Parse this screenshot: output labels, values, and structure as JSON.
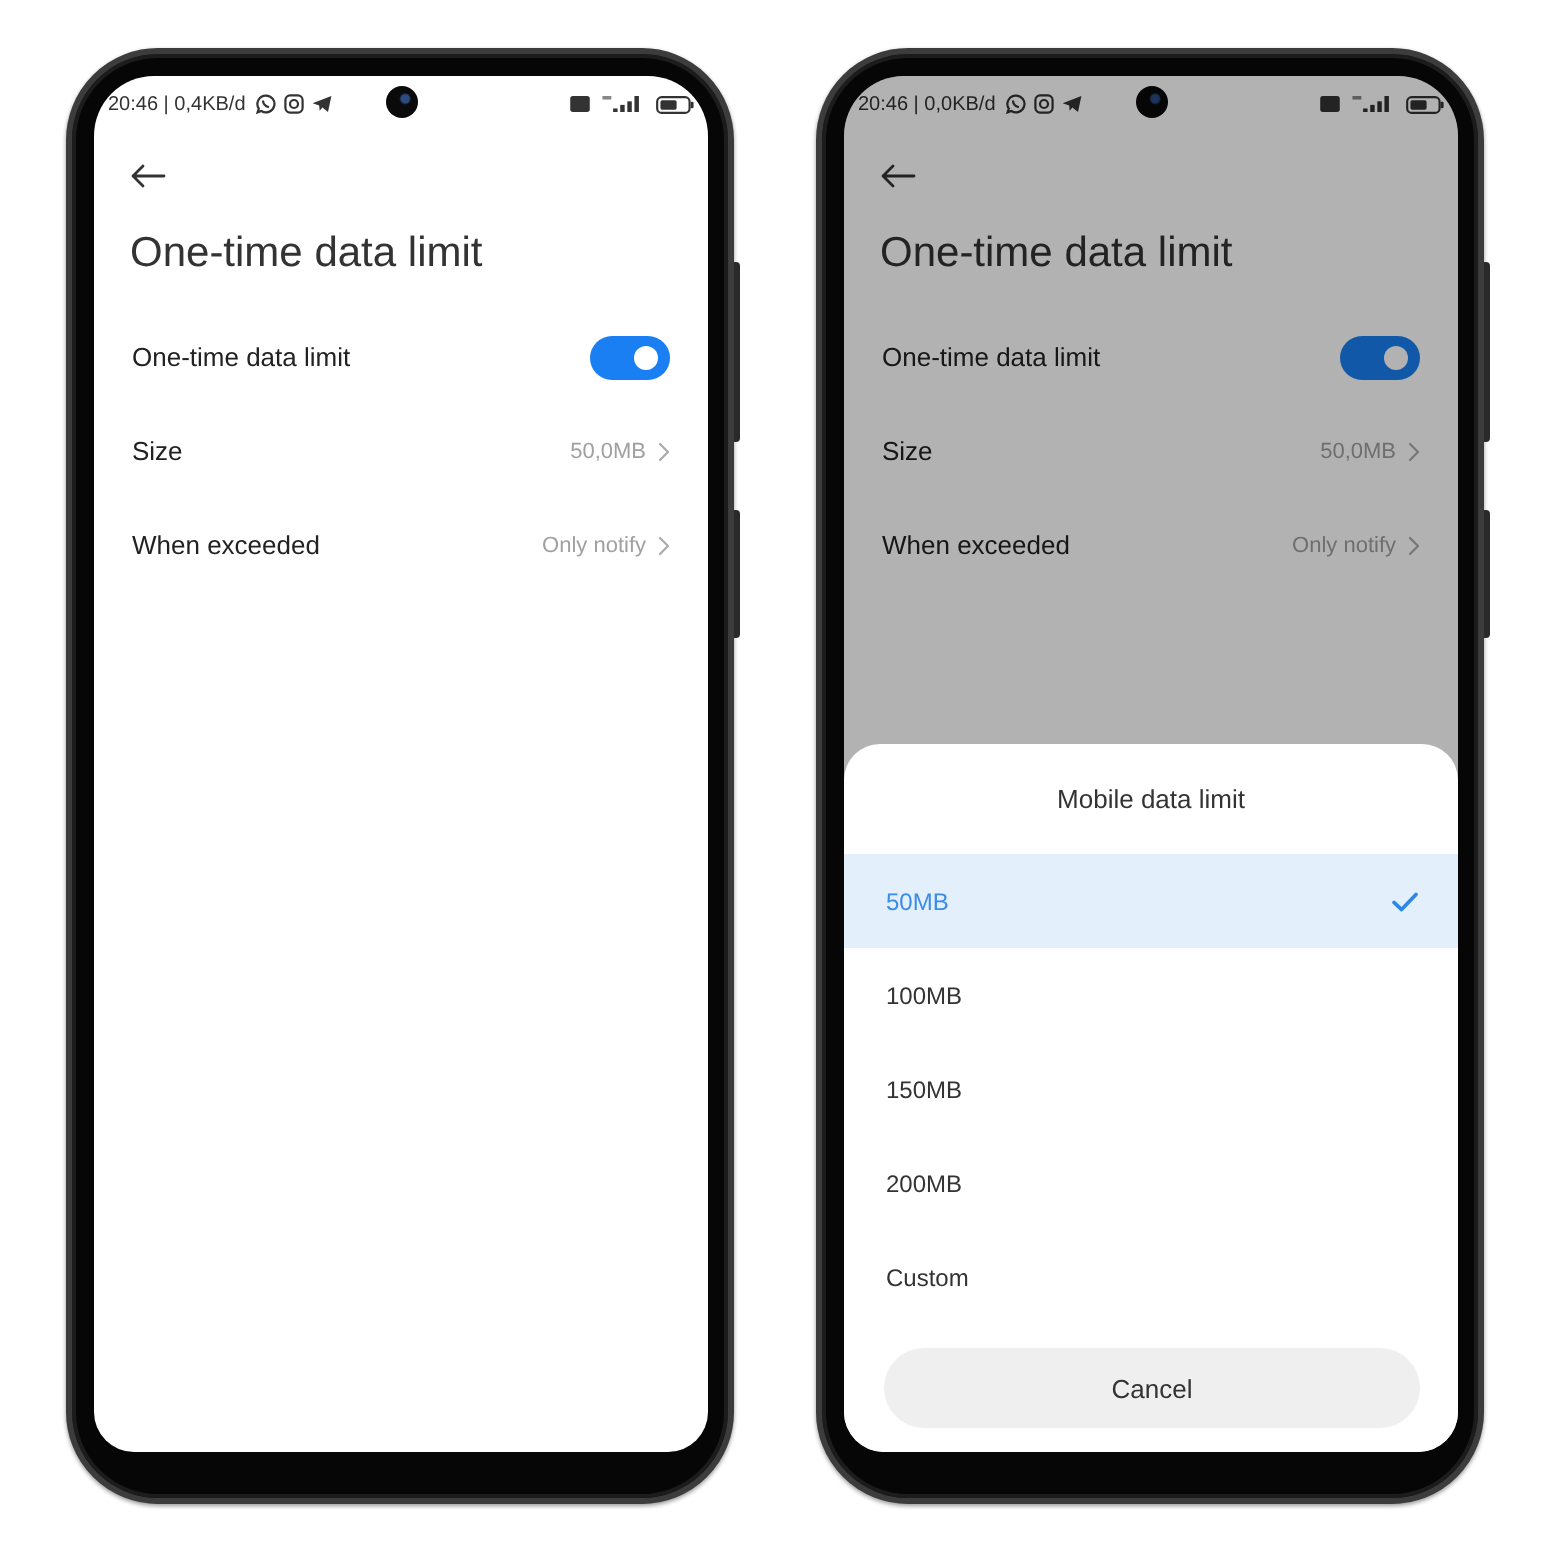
{
  "phones": [
    {
      "status_bar": {
        "text": "20:46 | 0,4KB/d"
      },
      "title": "One-time data limit",
      "dimmed": false,
      "settings": [
        {
          "kind": "toggle",
          "label": "One-time data limit",
          "on": true
        },
        {
          "kind": "link",
          "label": "Size",
          "value": "50,0MB"
        },
        {
          "kind": "link",
          "label": "When exceeded",
          "value": "Only notify"
        }
      ]
    },
    {
      "status_bar": {
        "text": "20:46 | 0,0KB/d"
      },
      "title": "One-time data limit",
      "dimmed": true,
      "settings": [
        {
          "kind": "toggle",
          "label": "One-time data limit",
          "on": true
        },
        {
          "kind": "link",
          "label": "Size",
          "value": "50,0MB"
        },
        {
          "kind": "link",
          "label": "When exceeded",
          "value": "Only notify"
        }
      ],
      "sheet": {
        "title": "Mobile data limit",
        "options": [
          {
            "label": "50MB",
            "selected": true
          },
          {
            "label": "100MB",
            "selected": false
          },
          {
            "label": "150MB",
            "selected": false
          },
          {
            "label": "200MB",
            "selected": false
          },
          {
            "label": "Custom",
            "selected": false
          }
        ],
        "cancel": "Cancel"
      }
    }
  ]
}
